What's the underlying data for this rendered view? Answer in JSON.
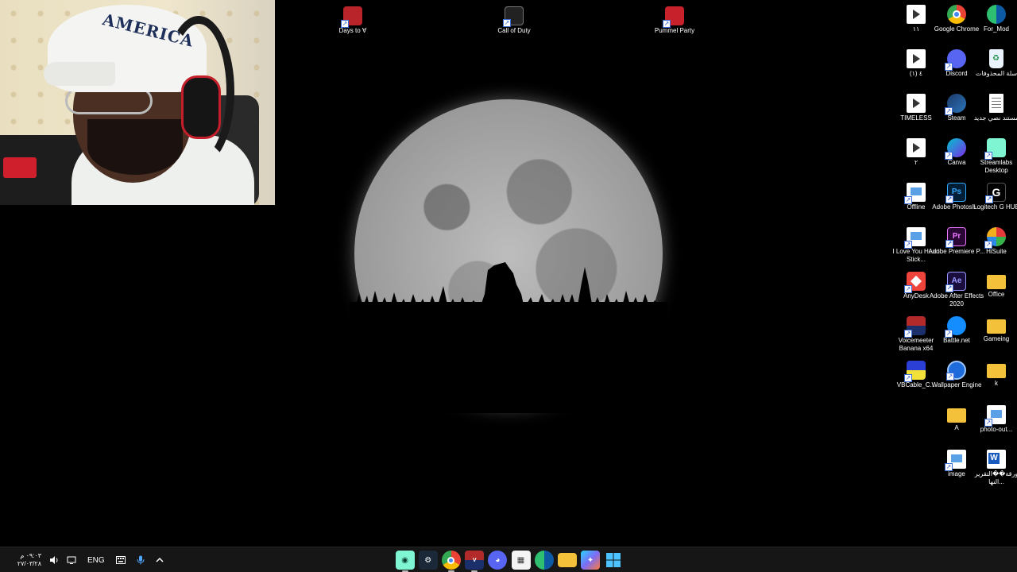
{
  "webcam": {
    "cap_text": "AMERICA"
  },
  "top_icons": [
    {
      "label": "Days to ∀",
      "icon": "days-to-die-icon",
      "color": "#b8242a"
    },
    {
      "label": "Call of Duty",
      "icon": "call-of-duty-icon",
      "color": "#222222"
    },
    {
      "label": "Pummel Party",
      "icon": "pummel-party-icon",
      "color": "#c7222c"
    }
  ],
  "right_icons": {
    "col1": [
      {
        "label": "١١",
        "icon": "video-file-icon"
      },
      {
        "label": "٤ (١)",
        "icon": "video-file-icon"
      },
      {
        "label": "TIMELESS",
        "icon": "video-file-icon"
      },
      {
        "label": "٢",
        "icon": "video-file-icon"
      },
      {
        "label": "Offline",
        "icon": "image-file-icon"
      },
      {
        "label": "I Love You Heart Stick...",
        "icon": "image-file-icon"
      },
      {
        "label": "AnyDesk",
        "icon": "anydesk-icon"
      },
      {
        "label": "Voicemeeter Banana x64",
        "icon": "voicemeeter-icon"
      },
      {
        "label": "VBCable_C...",
        "icon": "vbcable-icon"
      }
    ],
    "col2": [
      {
        "label": "Google Chrome",
        "icon": "chrome-icon"
      },
      {
        "label": "Discord",
        "icon": "discord-icon"
      },
      {
        "label": "Steam",
        "icon": "steam-icon"
      },
      {
        "label": "Canva",
        "icon": "canva-icon"
      },
      {
        "label": "Adobe Photosh...",
        "icon": "photoshop-icon"
      },
      {
        "label": "Adobe Premiere P...",
        "icon": "premiere-icon"
      },
      {
        "label": "Adobe After Effects 2020",
        "icon": "after-effects-icon"
      },
      {
        "label": "Battle.net",
        "icon": "battle-net-icon"
      },
      {
        "label": "Wallpaper Engine",
        "icon": "wallpaper-engine-icon"
      },
      {
        "label": "A",
        "icon": "folder-icon"
      },
      {
        "label": "image",
        "icon": "image-file-icon"
      }
    ],
    "col3": [
      {
        "label": "For_Mod",
        "icon": "edge-icon"
      },
      {
        "label": "سلة المحذوفات",
        "icon": "recycle-bin-icon"
      },
      {
        "label": "مستند نصي جديد",
        "icon": "text-document-icon"
      },
      {
        "label": "Streamlabs Desktop",
        "icon": "streamlabs-icon"
      },
      {
        "label": "Logitech G HUB",
        "icon": "logitech-ghub-icon"
      },
      {
        "label": "HiSuite",
        "icon": "hisuite-icon"
      },
      {
        "label": "Office",
        "icon": "folder-icon"
      },
      {
        "label": "Gameing",
        "icon": "folder-icon"
      },
      {
        "label": "k",
        "icon": "folder-icon"
      },
      {
        "label": "photo-out...",
        "icon": "image-file-icon"
      },
      {
        "label": "ورقة��التقرير النها...",
        "icon": "word-document-icon"
      }
    ]
  },
  "taskbar": {
    "time": "٠٩:٠٣ م",
    "date": "٢٧/٠٣/٢٨",
    "language": "ENG",
    "apps": [
      {
        "name": "streamlabs-taskbar-icon",
        "color": "#80f5d2",
        "glyph": "◉",
        "active": true
      },
      {
        "name": "steam-taskbar-icon",
        "color": "#1b2838",
        "glyph": "⚙",
        "active": false
      },
      {
        "name": "chrome-taskbar-icon",
        "color": "#e8eaed",
        "glyph": "◍",
        "active": true
      },
      {
        "name": "voicemeeter-taskbar-icon",
        "color": "#b32a2a",
        "glyph": "V",
        "active": true
      },
      {
        "name": "discord-taskbar-icon",
        "color": "#5865f2",
        "glyph": "◕",
        "active": false
      },
      {
        "name": "store-taskbar-icon",
        "color": "#f3f3f3",
        "glyph": "▦",
        "active": false
      },
      {
        "name": "edge-taskbar-icon",
        "color": "#1aa3a8",
        "glyph": "◒",
        "active": false
      },
      {
        "name": "file-explorer-taskbar-icon",
        "color": "#f3c13a",
        "glyph": "▭",
        "active": false
      },
      {
        "name": "copilot-taskbar-icon",
        "color": "#7b6cf6",
        "glyph": "✦",
        "active": false
      },
      {
        "name": "windows-start-icon",
        "color": "#4cc2ff",
        "glyph": "⊞",
        "active": false
      }
    ]
  }
}
